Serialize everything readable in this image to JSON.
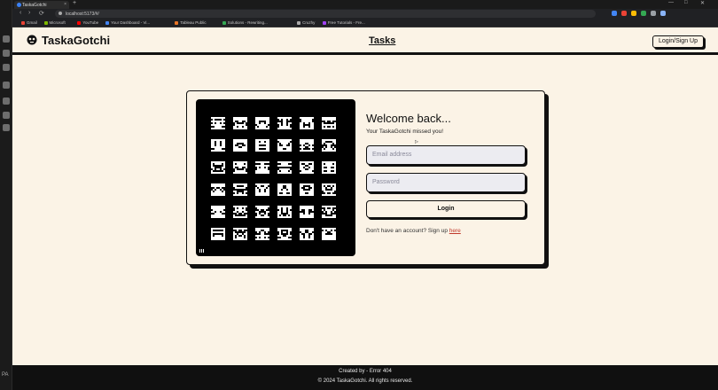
{
  "browser": {
    "tab_title": "TaskaGotchi",
    "tab_close": "×",
    "new_tab": "+",
    "window_controls": [
      "—",
      "□",
      "✕"
    ],
    "address": "localhost:5173/#/",
    "nav": {
      "back": "‹",
      "forward": "›",
      "reload": "⟳"
    },
    "bookmarks": [
      "Gmail",
      "Microsoft",
      "YouTube",
      "Your Dashboard - Vi...",
      "Tableau Public",
      "Solutions - Rewriting...",
      "Cruzhy",
      "Free Tutorials - Fre..."
    ],
    "bookmark_colors": [
      "#ea4335",
      "#7fba00",
      "#ff0000",
      "#4285f4",
      "#e97627",
      "#34a853",
      "#aaaaaa",
      "#a142f4"
    ],
    "extension_colors": [
      "#4285f4",
      "#ea4335",
      "#fbbc05",
      "#34a853",
      "#9aa0a6",
      "#8ab4f8"
    ]
  },
  "side_rail": {
    "bottom_label": "PA"
  },
  "header": {
    "brand": "TaskaGotchi",
    "nav_link": "Tasks",
    "login_button": "Login/Sign Up"
  },
  "login_card": {
    "heading": "Welcome back...",
    "tagline": "Your TaskaGotchi missed you!",
    "email_placeholder": "Email address",
    "password_placeholder": "Password",
    "submit_label": "Login",
    "signup_prompt": "Don't have an account? Sign up ",
    "signup_link": "here"
  },
  "mosaic": {
    "image": "pixel-pet-characters",
    "rows": 6,
    "cols": 6,
    "sprite_color": "#ffffff"
  },
  "footer": {
    "credit": "Created by - Error 404",
    "copyright": "© 2024 TaskaGotchi. All rights reserved."
  }
}
